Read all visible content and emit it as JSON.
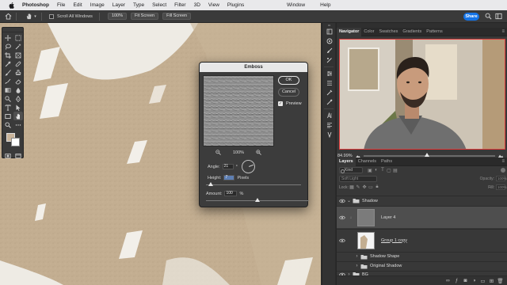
{
  "menubar": {
    "app_name": "Photoshop",
    "items": [
      "File",
      "Edit",
      "Image",
      "Layer",
      "Type",
      "Select",
      "Filter",
      "3D",
      "View",
      "Plugins"
    ],
    "right_items": [
      "Window",
      "Help"
    ]
  },
  "options_bar": {
    "scroll_all_windows_label": "Scroll All Windows",
    "scroll_all_windows_checked": false,
    "zoom_button": "100%",
    "fit_screen_button": "Fit Screen",
    "fill_screen_button": "Fill Screen",
    "share_button": "Share"
  },
  "tools": {
    "foreground_color": "#c9b49a",
    "background_color": "#ffffff",
    "items": [
      "move-icon",
      "marquee-icon",
      "lasso-icon",
      "magic-wand-icon",
      "crop-icon",
      "frame-icon",
      "eyedropper-icon",
      "healing-icon",
      "brush-icon",
      "stamp-icon",
      "history-brush-icon",
      "eraser-icon",
      "gradient-icon",
      "blur-icon",
      "dodge-icon",
      "pen-icon",
      "type-icon",
      "path-select-icon",
      "rectangle-icon",
      "hand-icon",
      "zoom-icon",
      "more-tools-icon"
    ],
    "active": "hand-icon"
  },
  "navigator_panel": {
    "tabs": [
      "Navigator",
      "Color",
      "Swatches",
      "Gradients",
      "Patterns"
    ],
    "active_tab": "Navigator",
    "zoom_value": "84.99%",
    "zoom_slider_fraction": 0.48
  },
  "layers_panel": {
    "tabs": [
      "Layers",
      "Channels",
      "Paths"
    ],
    "active_tab": "Layers",
    "kind_filter": "Kind",
    "blend_mode": "Soft Light",
    "opacity_label": "Opacity:",
    "opacity_value": "100%",
    "lock_label": "Lock:",
    "fill_label": "Fill:",
    "fill_value": "100%",
    "layers": [
      {
        "name": "Shadow",
        "type": "group",
        "expanded": true,
        "visible": true,
        "selected": false
      },
      {
        "name": "Layer 4",
        "type": "layer",
        "visible": true,
        "selected": true
      },
      {
        "name": "Group 1 copy",
        "type": "smart",
        "visible": true,
        "selected": false
      },
      {
        "name": "Shadow Shape",
        "type": "group",
        "expanded": false,
        "visible": false,
        "selected": false
      },
      {
        "name": "Original Shadow",
        "type": "group",
        "expanded": false,
        "visible": false,
        "selected": false
      },
      {
        "name": "BG",
        "type": "group",
        "expanded": false,
        "visible": true,
        "selected": false
      }
    ]
  },
  "emboss_dialog": {
    "title": "Emboss",
    "ok_label": "OK",
    "cancel_label": "Cancel",
    "preview_label": "Preview",
    "preview_checked": true,
    "zoom_value": "100%",
    "angle_label": "Angle:",
    "angle_value": "21",
    "angle_unit": "°",
    "height_label": "Height:",
    "height_value": "7",
    "height_unit": "Pixels",
    "height_slider_fraction": 0.05,
    "amount_label": "Amount:",
    "amount_value": "100",
    "amount_unit": "%",
    "amount_slider_fraction": 0.5
  }
}
